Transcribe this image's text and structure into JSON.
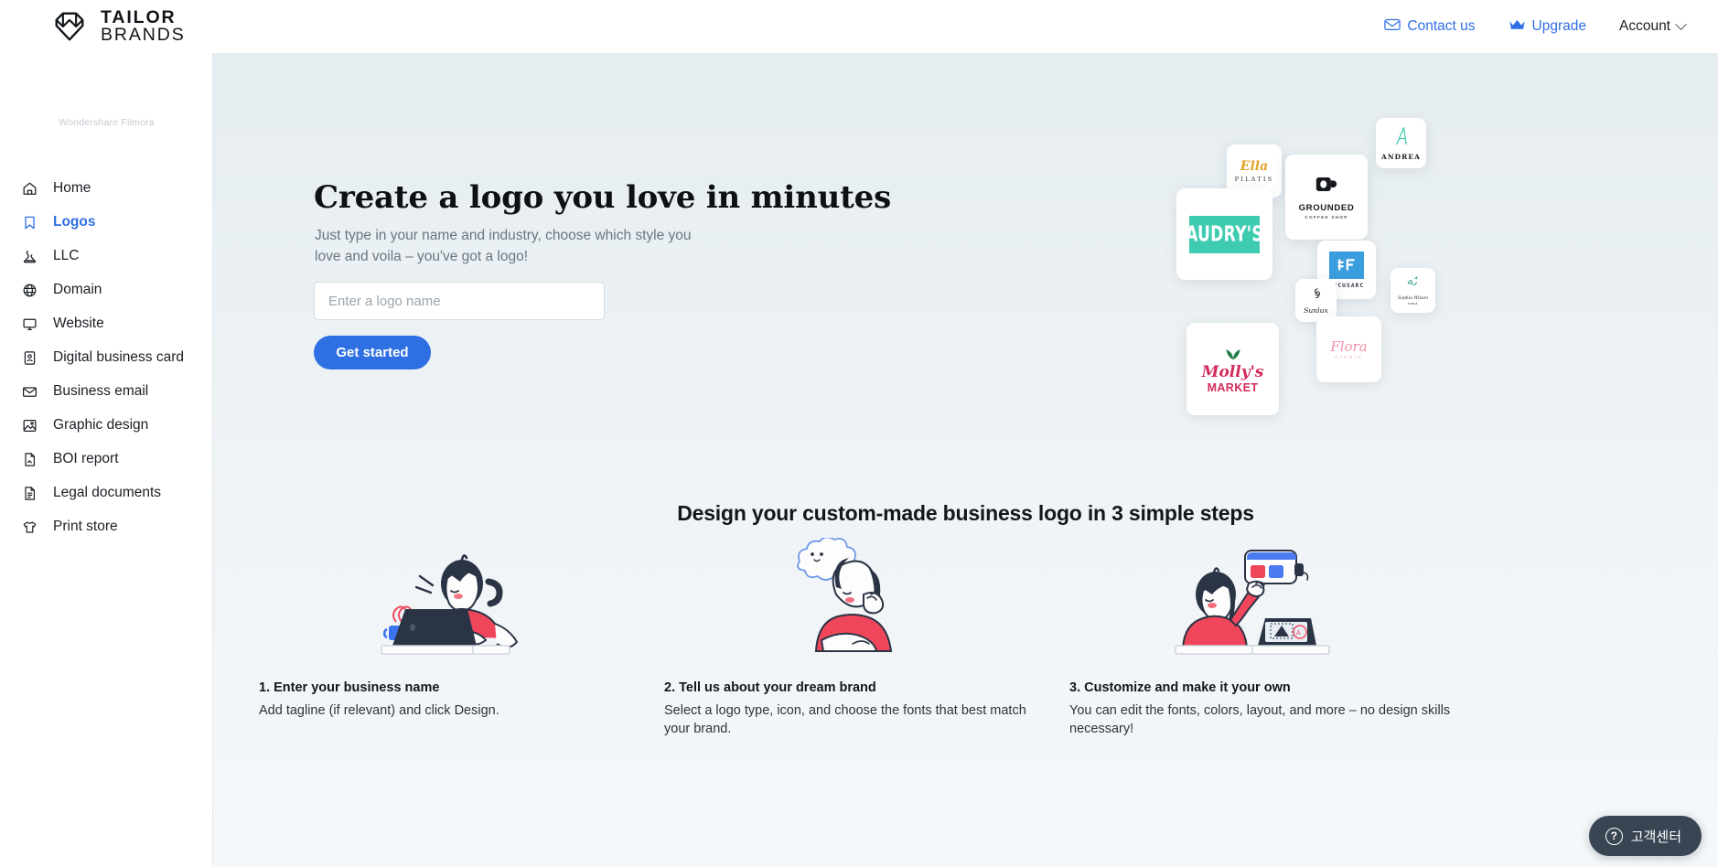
{
  "topbar": {
    "brand": {
      "line1": "TAILOR",
      "line2": "BRANDS",
      "icon": "tailor-brands-heart-logo"
    },
    "nav": [
      {
        "label": "Contact us",
        "icon": "envelope-icon",
        "color": "#2f6fe4"
      },
      {
        "label": "Upgrade",
        "icon": "crown-icon",
        "color": "#2f6fe4"
      },
      {
        "label": "Account",
        "icon": "chevron-down-icon",
        "color": "#1b1f24"
      }
    ]
  },
  "sidebar": {
    "watermark": "Wondershare Filmora",
    "items": [
      {
        "label": "Home",
        "icon": "home-icon",
        "active": false
      },
      {
        "label": "Logos",
        "icon": "bookmark-icon",
        "active": true
      },
      {
        "label": "LLC",
        "icon": "stamp-icon",
        "active": false
      },
      {
        "label": "Domain",
        "icon": "globe-icon",
        "active": false
      },
      {
        "label": "Website",
        "icon": "monitor-icon",
        "active": false
      },
      {
        "label": "Digital business card",
        "icon": "id-card-icon",
        "active": false
      },
      {
        "label": "Business email",
        "icon": "envelope-icon",
        "active": false
      },
      {
        "label": "Graphic design",
        "icon": "image-icon",
        "active": false
      },
      {
        "label": "BOI report",
        "icon": "document-icon",
        "active": false
      },
      {
        "label": "Legal documents",
        "icon": "file-text-icon",
        "active": false
      },
      {
        "label": "Print store",
        "icon": "tshirt-icon",
        "active": false
      }
    ]
  },
  "hero": {
    "title": "Create a logo you love in minutes",
    "subtitle": "Just type in your name and industry, choose which style you love and voila – you've got a logo!",
    "input_placeholder": "Enter a logo name",
    "input_value": "",
    "cta_label": "Get started",
    "cta_color": "#2f6fe4"
  },
  "collage": {
    "cards": [
      {
        "name": "Ella",
        "sub": "PILATIS",
        "accent": "#e0a326"
      },
      {
        "name": "GROUNDED",
        "sub": "COFFEE SHOP",
        "accent": "#15181c"
      },
      {
        "name": "ANDREA",
        "sub": "",
        "accent": "#3ecbb0"
      },
      {
        "name": "AUDRY'S",
        "sub": "",
        "accent": "#3ecbb0"
      },
      {
        "name": "FOCUSARC",
        "sub": "",
        "accent": "#3a9ddd"
      },
      {
        "name": "Sophia Wilson",
        "sub": "YOGA",
        "accent": "#2f9e8f"
      },
      {
        "name": "Sunlux",
        "sub": "",
        "accent": "#14181d"
      },
      {
        "name": "Flora",
        "sub": "STUDIO",
        "accent": "#f090a8"
      },
      {
        "name": "Molly's",
        "sub": "MARKET",
        "accent": "#d42a5b"
      }
    ]
  },
  "steps_section": {
    "title": "Design your custom-made business logo in 3 simple steps",
    "steps": [
      {
        "heading": "1. Enter your business name",
        "body": "Add tagline (if relevant) and click Design.",
        "art": "woman-at-laptop-illustration"
      },
      {
        "heading": "2. Tell us about your dream brand",
        "body": "Select a logo type, icon, and choose the fonts that best match your brand.",
        "art": "woman-thinking-with-cloud-illustration"
      },
      {
        "heading": "3. Customize and make it your own",
        "body": "You can edit the fonts, colors, layout, and more – no design skills necessary!",
        "art": "woman-customizing-design-illustration"
      }
    ]
  },
  "help_widget": {
    "label": "고객센터",
    "icon": "question-circle-icon",
    "bg": "#3a4554"
  }
}
